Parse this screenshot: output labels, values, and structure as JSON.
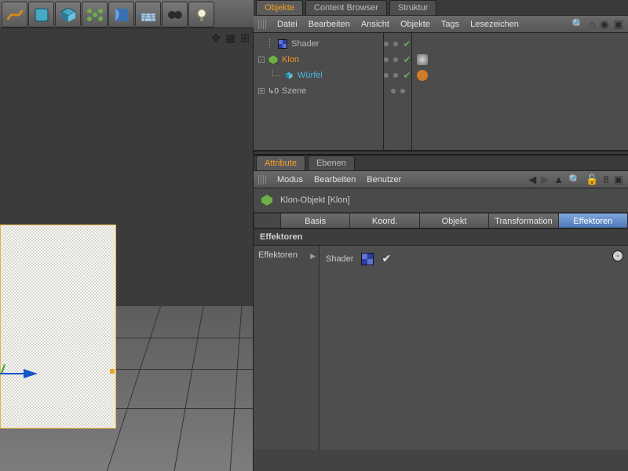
{
  "toolbar": {
    "tools": [
      "spline",
      "subdiv",
      "cube",
      "array",
      "boole",
      "floor",
      "camera",
      "light"
    ]
  },
  "objects_panel": {
    "tabs": {
      "objekte": "Objekte",
      "content": "Content Browser",
      "struktur": "Struktur"
    },
    "menu": {
      "datei": "Datei",
      "bearbeiten": "Bearbeiten",
      "ansicht": "Ansicht",
      "objekte": "Objekte",
      "tags": "Tags",
      "lesezeichen": "Lesezeichen"
    },
    "tree": {
      "shader": "Shader",
      "klon": "Klon",
      "wuerfel": "Würfel",
      "szene": "Szene"
    }
  },
  "attributes_panel": {
    "tabs": {
      "attribute": "Attribute",
      "ebenen": "Ebenen"
    },
    "menu": {
      "modus": "Modus",
      "bearbeiten": "Bearbeiten",
      "benutzer": "Benutzer"
    },
    "header": "Klon-Objekt [Klon]",
    "attr_tabs": {
      "basis": "Basis",
      "koord": "Koord.",
      "objekt": "Objekt",
      "transformation": "Transformation",
      "effektoren": "Effektoren"
    },
    "section": "Effektoren",
    "eff_label": "Effektoren",
    "eff_item": "Shader"
  }
}
